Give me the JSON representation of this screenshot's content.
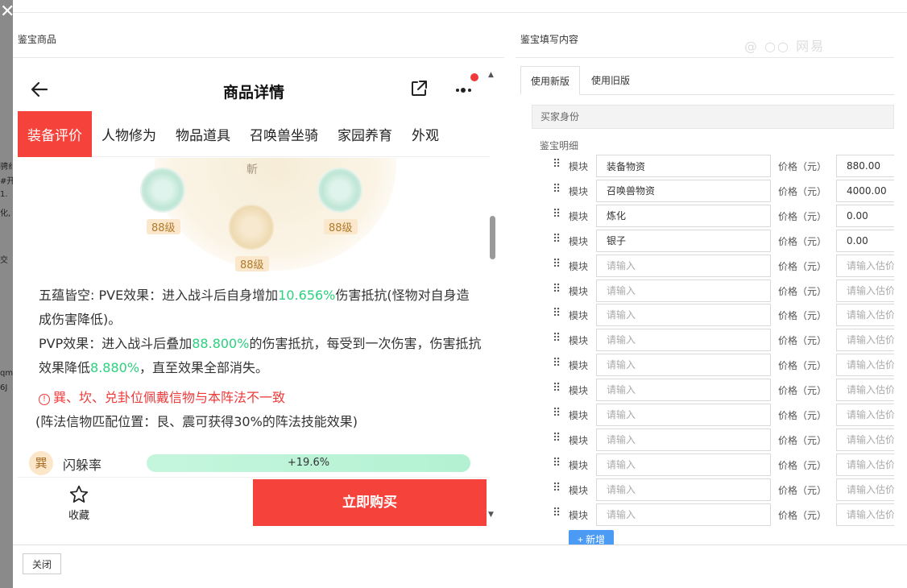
{
  "background": {
    "close_glyph": "✕",
    "fragments": [
      "骋纟",
      "#开",
      "1.",
      "化,",
      "交",
      "qm",
      "6J"
    ]
  },
  "left_panel": {
    "title": "鉴宝商品"
  },
  "right_panel": {
    "title": "鉴宝填写内容"
  },
  "watermark": "@ ○○ 网易",
  "phone": {
    "title": "商品详情",
    "tabs": [
      {
        "label": "装备评价",
        "active": true
      },
      {
        "label": "人物修为",
        "active": false
      },
      {
        "label": "物品道具",
        "active": false
      },
      {
        "label": "召唤兽坐骑",
        "active": false
      },
      {
        "label": "家园养育",
        "active": false
      },
      {
        "label": "外观",
        "active": false
      }
    ],
    "equip": {
      "top_char": "斬",
      "badges": [
        "88级",
        "88级",
        "88级"
      ]
    },
    "desc": {
      "line1_a": "五蕴皆空: PVE效果：进入战斗后自身增加",
      "line1_hl": "10.656%",
      "line1_b": "伤害抵抗(怪物对自身造成伤害降低)。",
      "line2_a": "PVP效果：进入战斗后叠加",
      "line2_hl": "88.800%",
      "line2_b": "的伤害抵抗，每受到一次伤害，伤害抵抗效果降低",
      "line2_hl2": "8.880%",
      "line2_c": "，直至效果全部消失。"
    },
    "warning": "巽、坎、兑卦位佩戴信物与本阵法不一致",
    "note": "(阵法信物匹配位置：艮、震可获得30%的阵法技能效果)",
    "stat": {
      "icon_char": "巽",
      "label": "闪躲率",
      "value": "+19.6%",
      "fill": 1.0
    },
    "favorite_label": "收藏",
    "buy_label": "立即购买"
  },
  "form": {
    "tabs": [
      {
        "label": "使用新版",
        "active": true
      },
      {
        "label": "使用旧版",
        "active": false
      }
    ],
    "section_title": "买家身份",
    "subsection_title": "鉴宝明细",
    "row_label": "模块",
    "price_label": "价格（元）",
    "module_placeholder": "请输入",
    "price_placeholder": "请输入估价价格",
    "rows": [
      {
        "module": "装备物资",
        "price": "880.00"
      },
      {
        "module": "召唤兽物资",
        "price": "4000.00"
      },
      {
        "module": "炼化",
        "price": "0.00"
      },
      {
        "module": "银子",
        "price": "0.00"
      },
      {
        "module": "",
        "price": ""
      },
      {
        "module": "",
        "price": ""
      },
      {
        "module": "",
        "price": ""
      },
      {
        "module": "",
        "price": ""
      },
      {
        "module": "",
        "price": ""
      },
      {
        "module": "",
        "price": ""
      },
      {
        "module": "",
        "price": ""
      },
      {
        "module": "",
        "price": ""
      },
      {
        "module": "",
        "price": ""
      },
      {
        "module": "",
        "price": ""
      },
      {
        "module": "",
        "price": ""
      }
    ],
    "add_label": "+ 新增"
  },
  "footer": {
    "close_label": "关闭"
  }
}
